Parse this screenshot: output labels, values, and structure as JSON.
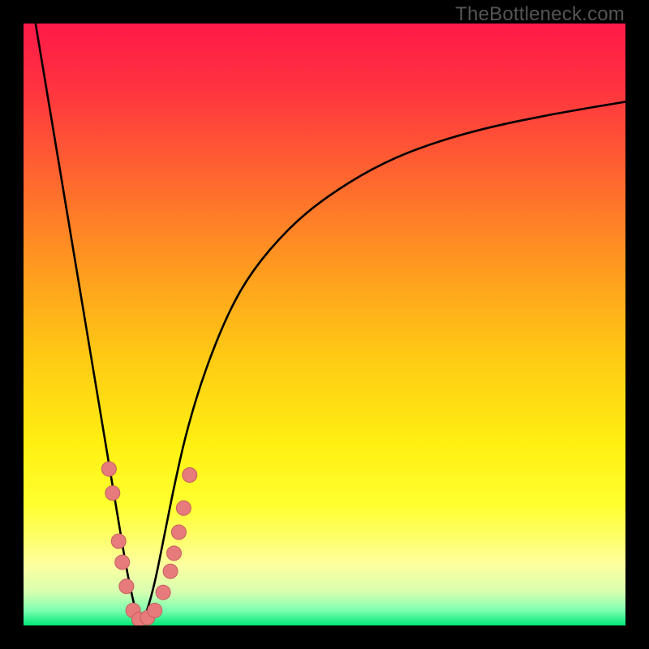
{
  "watermark": "TheBottleneck.com",
  "colors": {
    "frame": "#000000",
    "curve": "#000000",
    "marker_fill": "#e77b7b",
    "marker_stroke": "#c45e5e",
    "gradient_stops": [
      {
        "offset": 0.0,
        "color": "#ff1a49"
      },
      {
        "offset": 0.1,
        "color": "#ff3140"
      },
      {
        "offset": 0.25,
        "color": "#ff6430"
      },
      {
        "offset": 0.4,
        "color": "#ff9820"
      },
      {
        "offset": 0.55,
        "color": "#ffc914"
      },
      {
        "offset": 0.7,
        "color": "#fff012"
      },
      {
        "offset": 0.8,
        "color": "#ffff30"
      },
      {
        "offset": 0.86,
        "color": "#ffff70"
      },
      {
        "offset": 0.9,
        "color": "#fdffa0"
      },
      {
        "offset": 0.945,
        "color": "#d6ffb0"
      },
      {
        "offset": 0.975,
        "color": "#7dffb0"
      },
      {
        "offset": 1.0,
        "color": "#00e878"
      }
    ]
  },
  "chart_data": {
    "type": "line",
    "title": "",
    "xlabel": "",
    "ylabel": "",
    "xlim": [
      0,
      100
    ],
    "ylim": [
      0,
      100
    ],
    "note": "x and y are in percent of plot width/height; y=0 is bottom (green), y=100 is top (red). Curve is a V-shaped bottleneck profile with minimum near x≈19.",
    "series": [
      {
        "name": "bottleneck-curve",
        "x": [
          2.0,
          4.0,
          6.0,
          8.0,
          10.0,
          12.0,
          13.0,
          14.0,
          15.0,
          16.0,
          17.0,
          18.0,
          19.0,
          20.0,
          21.0,
          22.0,
          23.0,
          24.0,
          25.0,
          27.0,
          30.0,
          34.0,
          38.0,
          44.0,
          50.0,
          58.0,
          66.0,
          76.0,
          88.0,
          100.0
        ],
        "y": [
          100.0,
          88.0,
          76.0,
          64.0,
          52.0,
          40.0,
          34.0,
          28.0,
          22.0,
          16.0,
          10.0,
          5.0,
          1.0,
          1.0,
          4.0,
          8.0,
          13.0,
          18.0,
          23.0,
          32.0,
          42.0,
          52.0,
          59.0,
          66.0,
          71.0,
          76.0,
          79.5,
          82.5,
          85.0,
          87.0
        ]
      }
    ],
    "markers": {
      "name": "highlighted-points",
      "note": "Pink dot markers clustered near the valley of the curve.",
      "points": [
        {
          "x": 14.2,
          "y": 26.0
        },
        {
          "x": 14.8,
          "y": 22.0
        },
        {
          "x": 15.8,
          "y": 14.0
        },
        {
          "x": 16.4,
          "y": 10.5
        },
        {
          "x": 17.1,
          "y": 6.5
        },
        {
          "x": 18.2,
          "y": 2.5
        },
        {
          "x": 19.2,
          "y": 1.0
        },
        {
          "x": 20.6,
          "y": 1.3
        },
        {
          "x": 21.8,
          "y": 2.5
        },
        {
          "x": 23.2,
          "y": 5.5
        },
        {
          "x": 24.4,
          "y": 9.0
        },
        {
          "x": 25.0,
          "y": 12.0
        },
        {
          "x": 25.8,
          "y": 15.5
        },
        {
          "x": 26.6,
          "y": 19.5
        },
        {
          "x": 27.6,
          "y": 25.0
        }
      ]
    }
  }
}
